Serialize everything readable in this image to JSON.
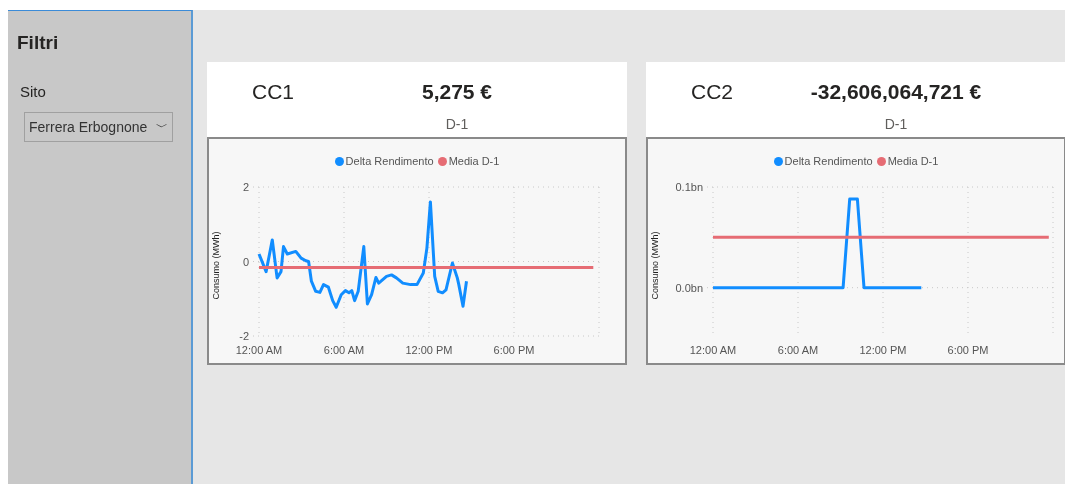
{
  "sidebar": {
    "title": "Filtri",
    "filter_label": "Sito",
    "dropdown": {
      "value": "Ferrera Erbognone",
      "caret": "﹀"
    }
  },
  "cards": [
    {
      "title": "CC1",
      "value": "5,275 €",
      "subtitle": "D-1",
      "chart_data": {
        "type": "line",
        "grid": true,
        "legend": true,
        "ylabel": "Consumo (MWh)",
        "xlim": [
          0,
          24
        ],
        "ylim": [
          -2,
          2
        ],
        "xticks": [
          {
            "value": 0,
            "label": "12:00 AM"
          },
          {
            "value": 6,
            "label": "6:00 AM"
          },
          {
            "value": 12,
            "label": "12:00 PM"
          },
          {
            "value": 18,
            "label": "6:00 PM"
          }
        ],
        "yticks": [
          -2,
          0,
          2
        ],
        "x": [
          0,
          0.5,
          0.94,
          1.28,
          1.55,
          1.73,
          2.0,
          2.6,
          2.97,
          3.3,
          3.5,
          3.7,
          4.0,
          4.3,
          4.55,
          4.9,
          5.2,
          5.45,
          5.8,
          6.1,
          6.35,
          6.55,
          6.75,
          7.0,
          7.4,
          7.65,
          7.95,
          8.25,
          8.45,
          9.0,
          9.35,
          9.7,
          10.15,
          10.7,
          11.15,
          11.6,
          11.85,
          12.1,
          12.4,
          12.65,
          12.95,
          13.2,
          13.65,
          14.0,
          14.1,
          14.4,
          14.65,
          23.6
        ],
        "series": [
          {
            "name": "Delta Rendimento",
            "color": "#118dff",
            "values": [
              0.2,
              -0.27,
              0.58,
              -0.44,
              -0.27,
              0.4,
              0.2,
              0.27,
              0.09,
              0.02,
              0,
              -0.53,
              -0.8,
              -0.83,
              -0.62,
              -0.69,
              -1.05,
              -1.23,
              -0.89,
              -0.78,
              -0.84,
              -0.78,
              -1.05,
              -0.8,
              0.4,
              -1.14,
              -0.89,
              -0.43,
              -0.58,
              -0.4,
              -0.36,
              -0.44,
              -0.58,
              -0.62,
              -0.62,
              -0.31,
              0.36,
              1.6,
              -0.4,
              -0.8,
              -0.84,
              -0.76,
              -0.04,
              -0.44,
              -0.62,
              -1.2,
              -0.53,
              null
            ]
          },
          {
            "name": "Media D-1",
            "color": "#e66c74",
            "values": [
              -0.16,
              -0.16,
              -0.16,
              -0.16,
              -0.16,
              -0.16,
              -0.16,
              -0.16,
              -0.16,
              -0.16,
              -0.16,
              -0.16,
              -0.16,
              -0.16,
              -0.16,
              -0.16,
              -0.16,
              -0.16,
              -0.16,
              -0.16,
              -0.16,
              -0.16,
              -0.16,
              -0.16,
              -0.16,
              -0.16,
              -0.16,
              -0.16,
              -0.16,
              -0.16,
              -0.16,
              -0.16,
              -0.16,
              -0.16,
              -0.16,
              -0.16,
              -0.16,
              -0.16,
              -0.16,
              -0.16,
              -0.16,
              -0.16,
              -0.16,
              -0.16,
              -0.16,
              -0.16,
              -0.16,
              -0.16
            ]
          }
        ]
      }
    },
    {
      "title": "CC2",
      "value": "-32,606,064,721 €",
      "subtitle": "D-1",
      "chart_data": {
        "type": "line",
        "grid": true,
        "legend": true,
        "ylabel": "Consumo (MWh)",
        "xlim": [
          0,
          24
        ],
        "ylim": [
          -0.048,
          0.1
        ],
        "xticks": [
          {
            "value": 0,
            "label": "12:00 AM"
          },
          {
            "value": 6,
            "label": "6:00 AM"
          },
          {
            "value": 12,
            "label": "12:00 PM"
          },
          {
            "value": 18,
            "label": "6:00 PM"
          }
        ],
        "yticks": [
          {
            "value": 0,
            "label": "0.0bn"
          },
          {
            "value": 0.1,
            "label": "0.1bn"
          }
        ],
        "x": [
          0,
          9.18,
          9.65,
          10.19,
          10.66,
          14.7,
          23.7
        ],
        "series": [
          {
            "name": "Delta Rendimento",
            "color": "#118dff",
            "values": [
              0,
              0,
              0.088,
              0.088,
              0,
              0,
              null
            ]
          },
          {
            "name": "Media D-1",
            "color": "#e66c74",
            "values": [
              0.05,
              0.05,
              0.05,
              0.05,
              0.05,
              0.05,
              0.05
            ]
          }
        ]
      }
    }
  ]
}
